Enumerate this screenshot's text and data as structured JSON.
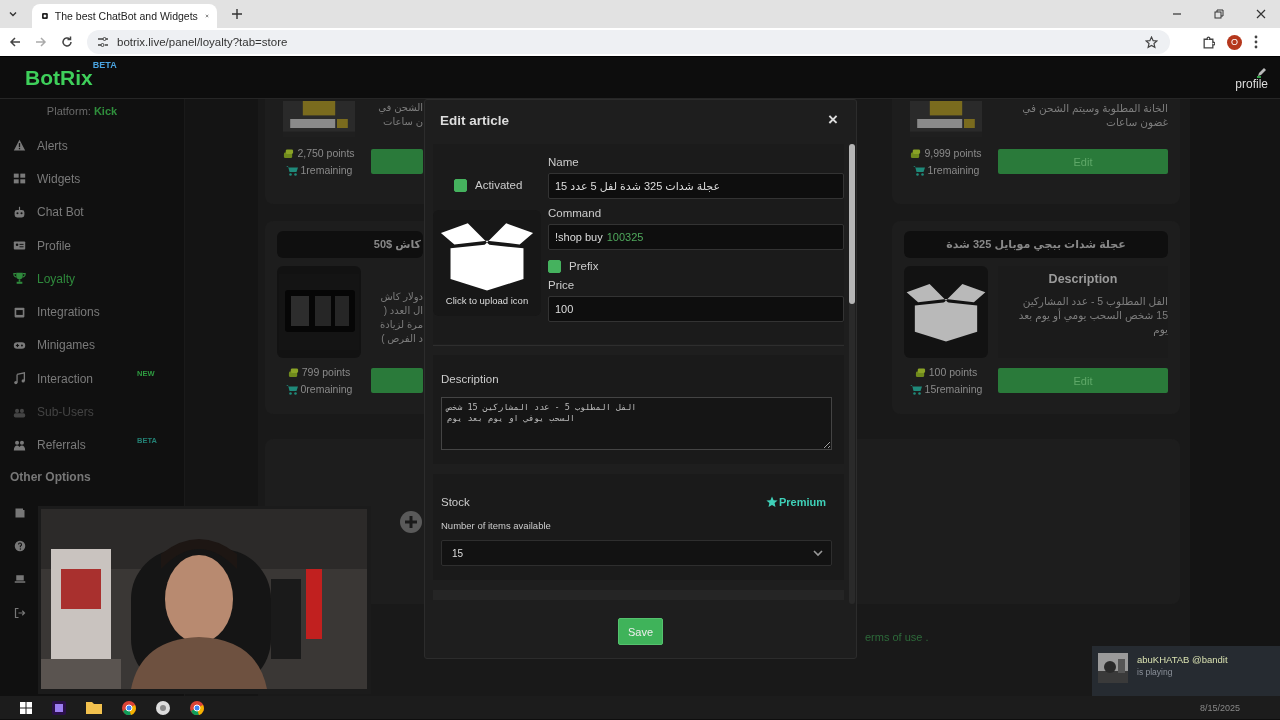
{
  "browser": {
    "tab_title": "The best ChatBot and Widgets",
    "url": "botrix.live/panel/loyalty?tab=store",
    "profile_initial": "O"
  },
  "app": {
    "logo": "BotRix",
    "logo_badge": "BETA",
    "profile_label": "profile"
  },
  "sidebar": {
    "platform_label": "Platform:",
    "platform": "Kick",
    "items": [
      {
        "label": "Alerts",
        "selected": false,
        "disabled": false
      },
      {
        "label": "Widgets",
        "selected": false,
        "disabled": false
      },
      {
        "label": "Chat Bot",
        "selected": false,
        "disabled": false
      },
      {
        "label": "Profile",
        "selected": false,
        "disabled": false
      },
      {
        "label": "Loyalty",
        "selected": true,
        "disabled": false
      },
      {
        "label": "Integrations",
        "selected": false,
        "disabled": false
      },
      {
        "label": "Minigames",
        "selected": false,
        "disabled": false
      },
      {
        "label": "Interaction",
        "selected": false,
        "disabled": false,
        "badge": {
          "text": "NEW",
          "kind": "new"
        }
      },
      {
        "label": "Sub-Users",
        "selected": false,
        "disabled": true
      },
      {
        "label": "Referrals",
        "selected": false,
        "disabled": false,
        "badge": {
          "text": "BETA",
          "kind": "beta"
        }
      }
    ],
    "section_title": "Other Options"
  },
  "store": {
    "left_cards": [
      {
        "description_lines": [
          "الشحن في",
          "ن ساعات"
        ],
        "points": "2,750 points",
        "remaining": "1remaining"
      },
      {
        "title": "كاش $50",
        "description_lines": [
          "دولار كاش",
          "ال العدد (",
          "مرة لزيادة",
          "د الفرص )"
        ],
        "points": "799 points",
        "remaining": "0remaining"
      }
    ],
    "right_cards": [
      {
        "description_lines": [
          "الخانة المطلوبة وسيتم الشحن في",
          "غضون ساعات"
        ],
        "points": "9,999 points",
        "remaining": "1remaining",
        "button": "Edit"
      },
      {
        "title": "عجلة شدات ببجي موبايل 325 شدة",
        "description_heading": "Description",
        "description_lines": [
          "الفل المطلوب 5 - عدد المشاركين",
          "15 شخص السحب يومي أو يوم بعد",
          "يوم"
        ],
        "points": "100 points",
        "remaining": "15remaining",
        "button": "Edit"
      }
    ],
    "footer_text": "erms of use ."
  },
  "modal": {
    "title": "Edit article",
    "close": "×",
    "activated": {
      "label": "Activated",
      "checked": true
    },
    "upload_caption": "Click to upload icon",
    "name": {
      "label": "Name",
      "value": "عجلة شدات 325 شدة لفل 5 عدد 15"
    },
    "command": {
      "label": "Command",
      "prefix": "!shop buy",
      "value": "100325"
    },
    "prefix": {
      "label": "Prefix",
      "checked": true
    },
    "price": {
      "label": "Price",
      "value": "100"
    },
    "description": {
      "label": "Description",
      "value": "الفل المطلوب 5 - عدد المشاركين 15 شخص\nالسحب يوفي او يوم بعد يوم"
    },
    "stock": {
      "label": "Stock",
      "badge": "Premium",
      "field_label": "Number of items available",
      "value": "15"
    },
    "save": "Save"
  },
  "notification": {
    "title": "abuKHATAB @bandit",
    "subtitle": "is playing"
  },
  "taskbar": {
    "date": "8/15/2025"
  }
}
